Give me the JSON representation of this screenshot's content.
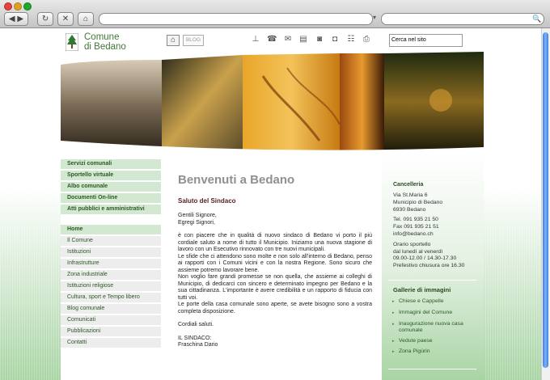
{
  "browser": {
    "search_glyph": "🔍"
  },
  "header": {
    "logo_line1": "Comune",
    "logo_line2": "di Bedano",
    "blog_label": "BLOG",
    "search_value": "Cerca nel sito"
  },
  "menu_main": [
    "Servizi comunali",
    "Sportello virtuale",
    "Albo comunale",
    "Documenti On-line",
    "Atti pubblici e amministrativi"
  ],
  "menu_sec": [
    "Home",
    "Il Comune",
    "Istituzioni",
    "Infrastrutture",
    "Zona industriale",
    "Istituzioni religiose",
    "Cultura, sport e Tempo libero",
    "Blog comunale",
    "Comunicati",
    "Pubblicazioni",
    "Contatti"
  ],
  "article": {
    "title": "Benvenuti a Bedano",
    "subtitle": "Saluto del Sindaco",
    "greeting1": "Gentili Signore,",
    "greeting2": "Egregi Signori,",
    "para1": "è con piacere che in qualità di nuovo sindaco di Bedano vi porto il più cordiale saluto a nome di tutto il Municipio. Iniziamo una nuova stagione di lavoro con un Esecutivo rinnovato con tre nuovi municipali.",
    "para2": "Le sfide che ci attendono sono molte e non solo all'interno di Bedano, penso ai rapporti con i Comuni vicini e con la nostra Regione. Sono sicuro che assieme potremo lavorare bene.",
    "para3": "Non voglio fare grandi promesse se non quella, che assieme ai colleghi di Municipio, di dedicarci con sincero e determinato impegno per Bedano e la sua cittadinanza. L'importante è avere credibilità e un rapporto di fiducia con tutti voi.",
    "para4": "Le porte della casa comunale sono aperte, se avete bisogno sono a vostra completa disposizione.",
    "closing": "Cordiali saluti.",
    "sign1": "IL SINDACO:",
    "sign2": "Fraschina Dario"
  },
  "contact": {
    "title": "Cancelleria",
    "address1": "Via St.Maria 6",
    "address2": "Municipio di Bedano",
    "address3": "6930 Bedano",
    "tel": "Tel. 091 935 21 50",
    "fax": "Fax 091 935 21 51",
    "email": "info@bedano.ch",
    "hours1": "Orario sportello",
    "hours2": "dal lunedì al venerdì",
    "hours3": "09.00-12.00 / 14.30-17.30",
    "hours4": "Prefestivo chiusura ore 16.30"
  },
  "gallery": {
    "title": "Gallerie di immagini",
    "items": [
      "Chiese e Cappelle",
      "Immagini del Comune",
      "Inaugurazione nuova casa comunale",
      "Vedute paese",
      "Zona Pigürin"
    ]
  },
  "colors": {
    "accent_green": "#3e7a34",
    "menu_green": "#d3e8d0",
    "subtitle_red": "#5a2222"
  }
}
